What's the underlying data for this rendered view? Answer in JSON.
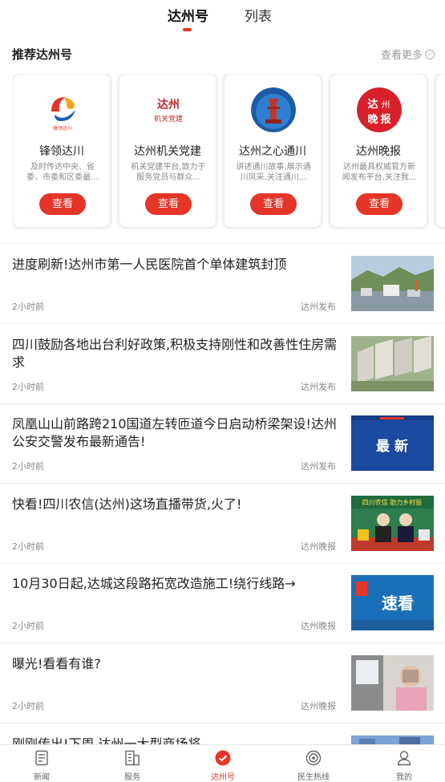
{
  "top_tabs": [
    {
      "label": "达州号",
      "active": true
    },
    {
      "label": "列表",
      "active": false
    }
  ],
  "recommend": {
    "title": "推荐达州号",
    "see_more": "查看更多",
    "cards": [
      {
        "name": "锋领达川",
        "desc": "及时传达中央、省委、市委和区委最...",
        "button": "查看",
        "logo_text": "锋领达川"
      },
      {
        "name": "达州机关党建",
        "desc": "机关党建平台,致力于服务党员与群众...",
        "button": "查看",
        "logo_text": "达州机关党建"
      },
      {
        "name": "达州之心通川",
        "desc": "讲述通川故事,展示通川风采,关注通川...",
        "button": "查看"
      },
      {
        "name": "达州晚报",
        "desc": "达州最具权威官方新闻发布平台,关注我...",
        "button": "查看",
        "logo_text": "达州晚报"
      }
    ]
  },
  "news": [
    {
      "title": "进度刷新!达州市第一人民医院首个单体建筑封顶",
      "time": "2小时前",
      "source": "达州发布"
    },
    {
      "title": "四川鼓励各地出台利好政策,积极支持刚性和改善性住房需求",
      "time": "2小时前",
      "source": "达州发布"
    },
    {
      "title": "凤凰山山前路跨210国道左转匝道今日启动桥梁架设!达州公安交警发布最新通告!",
      "time": "2小时前",
      "source": "达州发布",
      "thumb_text": "最 新"
    },
    {
      "title": "快看!四川农信(达州)这场直播带货,火了!",
      "time": "2小时前",
      "source": "达州晚报",
      "thumb_text": "四川农信 助力乡村振"
    },
    {
      "title": "10月30日起,达城这段路拓宽改造施工!绕行线路→",
      "time": "2小时前",
      "source": "达州晚报",
      "thumb_text": "速看"
    },
    {
      "title": "曝光!看看有谁?",
      "time": "2小时前",
      "source": "达州晚报"
    },
    {
      "title": "刚刚传出!下周,达州一大型商场将..."
    }
  ],
  "bottom_nav": [
    {
      "label": "新闻",
      "icon": "news-icon",
      "active": false
    },
    {
      "label": "服务",
      "icon": "service-icon",
      "active": false
    },
    {
      "label": "达州号",
      "icon": "dazhou-hao-icon",
      "active": true
    },
    {
      "label": "民生热线",
      "icon": "hotline-icon",
      "active": false
    },
    {
      "label": "我的",
      "icon": "profile-icon",
      "active": false
    }
  ],
  "colors": {
    "accent": "#e53528",
    "text": "#222222",
    "muted": "#888888"
  }
}
